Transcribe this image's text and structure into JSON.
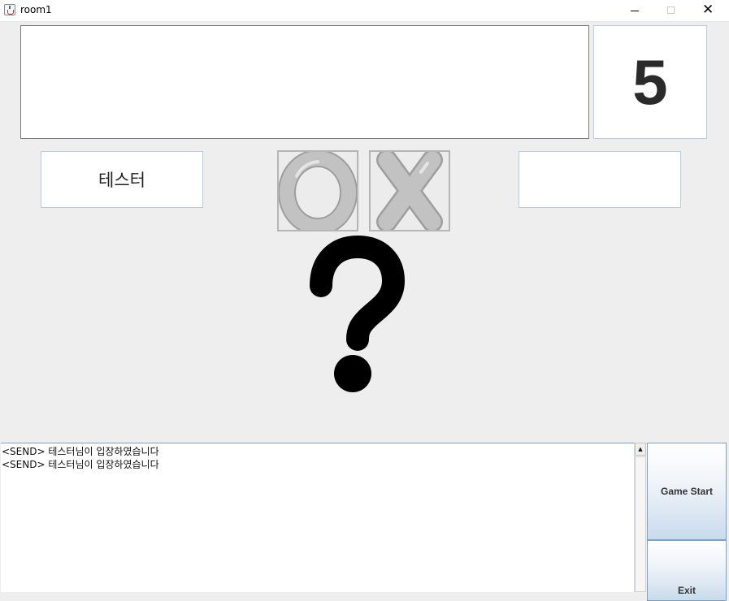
{
  "window": {
    "title": "room1",
    "controls": {
      "minimize": "minimize-icon",
      "maximize": "maximize-icon",
      "close": "close-icon"
    }
  },
  "question": {
    "text": ""
  },
  "timer": {
    "value": "5"
  },
  "players": {
    "left": {
      "name": "테스터"
    },
    "right": {
      "name": ""
    }
  },
  "answers": {
    "o_icon": "o-icon",
    "x_icon": "x-icon"
  },
  "status_icon": "question-mark-icon",
  "chat": {
    "lines": [
      "<SEND> 테스터님이 입장하였습니다",
      "<SEND> 테스터님이 입장하였습니다"
    ]
  },
  "buttons": {
    "start": "Game Start",
    "exit": "Exit"
  },
  "colors": {
    "background": "#eeeeee",
    "panel": "#ffffff",
    "accent_border": "#7aa3c8",
    "ox_gray": "#bdbdbd"
  }
}
